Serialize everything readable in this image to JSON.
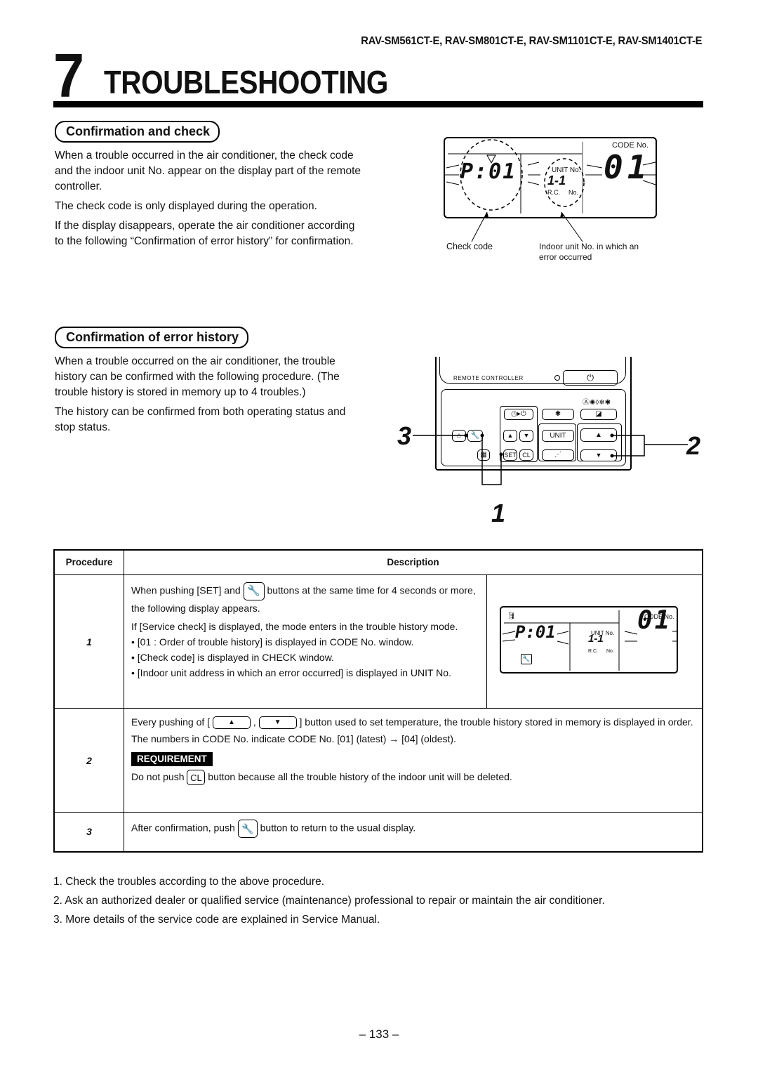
{
  "header": {
    "models": "RAV-SM561CT-E, RAV-SM801CT-E, RAV-SM1101CT-E, RAV-SM1401CT-E",
    "chapter_number": "7",
    "chapter_title": "TROUBLESHOOTING"
  },
  "section1": {
    "title": "Confirmation and check",
    "paragraphs": [
      "When a trouble occurred in the air conditioner, the check code and the indoor unit No. appear on the display part of the remote controller.",
      "The check code is only displayed during the operation.",
      "If the display disappears, operate the air conditioner according to the following “Confirmation of error history” for confirmation."
    ],
    "display": {
      "check_code": "P:01",
      "unit_no_label": "UNIT No.",
      "unit_value": "1-1",
      "rc_label": "R.C.",
      "no_label": "No.",
      "code_no_label": "CODE No.",
      "code_value": "01",
      "caption_check": "Check code",
      "caption_unit": "Indoor unit No. in which an error occurred"
    }
  },
  "section2": {
    "title": "Confirmation of error history",
    "paragraphs": [
      "When a trouble occurred on the air conditioner, the trouble history can be confirmed with the following procedure. (The trouble history is stored in memory up to 4 troubles.)",
      "The history can be confirmed from both operating status and stop status."
    ],
    "remote": {
      "label": "REMOTE CONTROLLER",
      "unit_button": "UNIT",
      "set_button": "SET",
      "cl_button": "CL",
      "callouts": [
        "3",
        "2",
        "1"
      ]
    }
  },
  "table": {
    "headers": [
      "Procedure",
      "Description"
    ],
    "rows": [
      {
        "step": "1",
        "line1_pre": "When pushing [SET] and",
        "line1_post": "buttons at the same time for 4 seconds or more, the following display appears.",
        "line2": "If [Service check] is displayed, the mode enters in the trouble history mode.",
        "bullets": [
          "[01 : Order of trouble history] is displayed in CODE No. window.",
          "[Check code] is displayed in CHECK window.",
          "[Indoor unit address in which an error occurred] is displayed in UNIT No."
        ],
        "display": {
          "check_code": "P:01",
          "unit_no_label": "UNIT No.",
          "unit_value": "1-1",
          "rc_label": "R.C.",
          "no_label": "No.",
          "code_no_label": "CODE No.",
          "code_value": "01"
        }
      },
      {
        "step": "2",
        "line1_pre": "Every pushing of [",
        "line1_mid": ",",
        "line1_post": "] button used to set temperature, the trouble history stored in memory is displayed in order.",
        "line2": "The numbers in CODE No. indicate CODE No.  [01] (latest) → [04] (oldest).",
        "requirement_label": "REQUIREMENT",
        "req_pre": "Do not push",
        "req_button": "CL",
        "req_post": "button because all the trouble history of the indoor unit will be deleted."
      },
      {
        "step": "3",
        "line1_pre": "After confirmation, push",
        "line1_post": "button to return to the usual display."
      }
    ]
  },
  "notes": [
    "1.  Check the troubles according to the above procedure.",
    "2.  Ask an authorized dealer or qualified service (maintenance) professional to repair or maintain the air conditioner.",
    "3.  More details of the service code are explained in Service Manual."
  ],
  "page_number": "– 133 –"
}
